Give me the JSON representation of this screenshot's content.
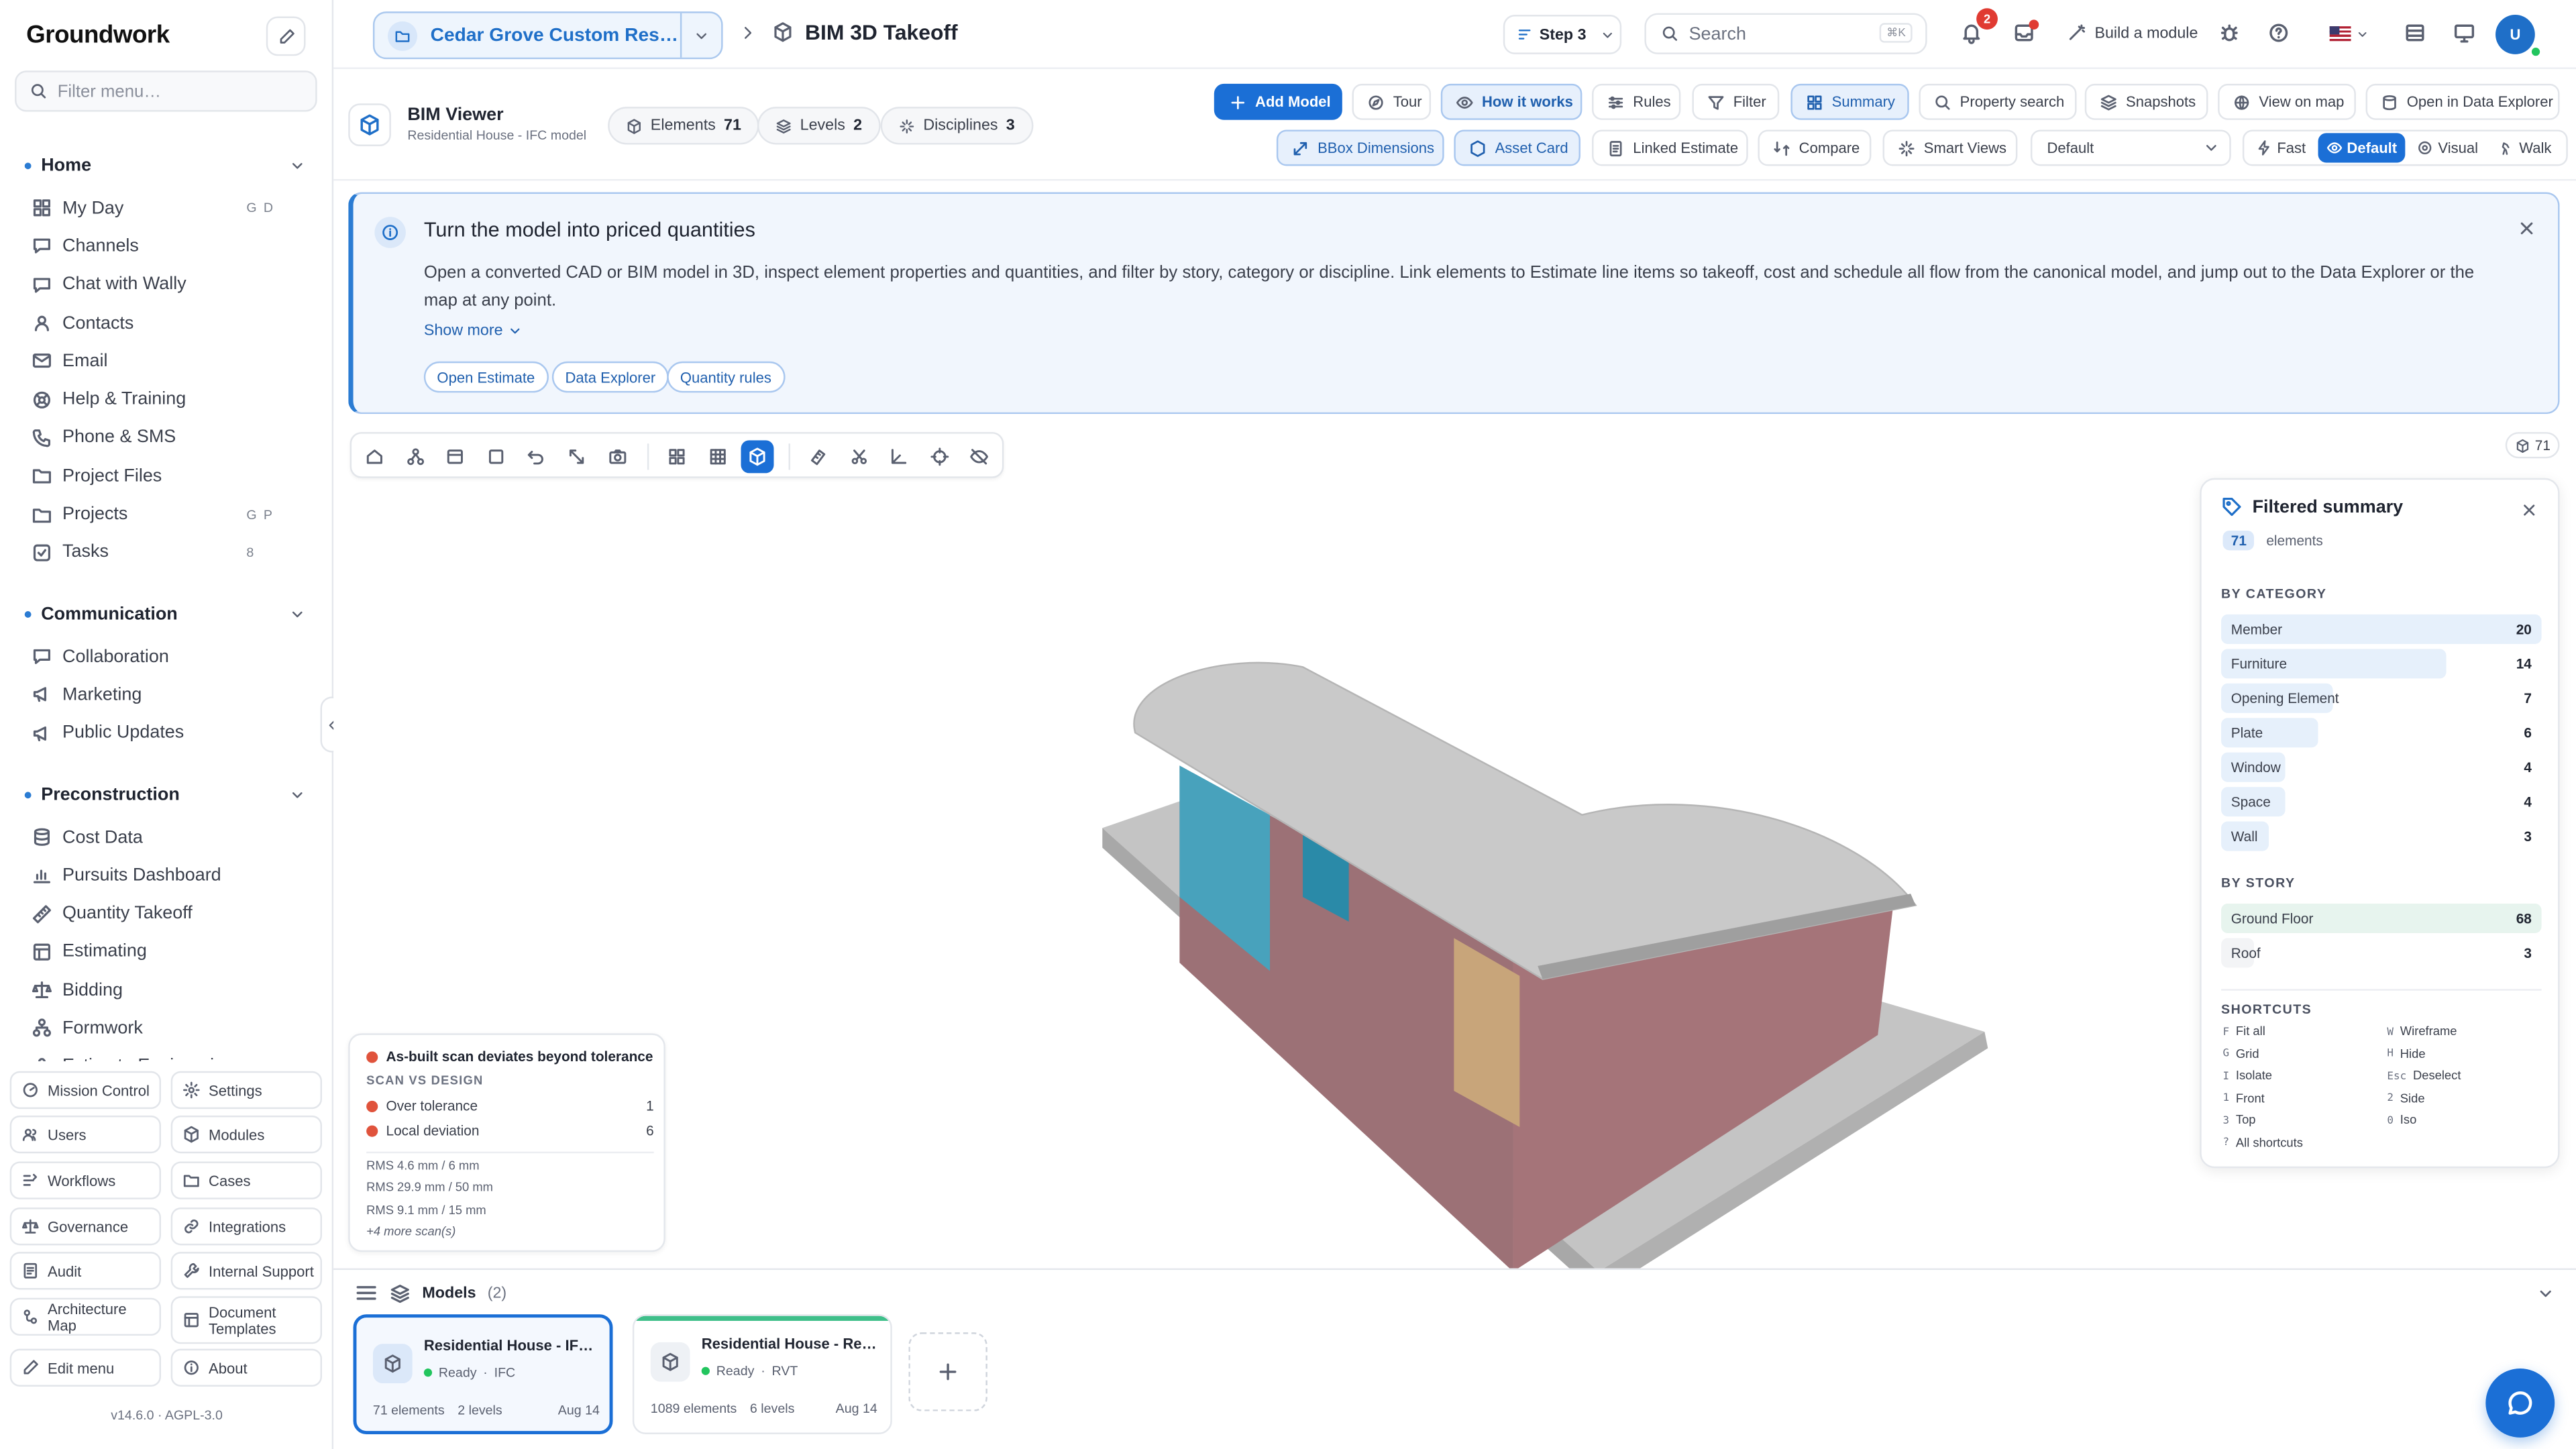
{
  "app": {
    "name": "Groundwork",
    "version": "v14.6.0",
    "license": "AGPL-3.0"
  },
  "sidebar": {
    "filter_placeholder": "Filter menu…",
    "sections": [
      {
        "title": "Home",
        "items": [
          {
            "label": "My Day",
            "icon": "grid-icon",
            "kbd": "G D"
          },
          {
            "label": "Channels",
            "icon": "chat-icon"
          },
          {
            "label": "Chat with Wally",
            "icon": "chat-icon"
          },
          {
            "label": "Contacts",
            "icon": "contacts-icon"
          },
          {
            "label": "Email",
            "icon": "mail-icon"
          },
          {
            "label": "Help & Training",
            "icon": "help-icon"
          },
          {
            "label": "Phone & SMS",
            "icon": "phone-icon"
          },
          {
            "label": "Project Files",
            "icon": "folder-icon"
          },
          {
            "label": "Projects",
            "icon": "folder-icon",
            "kbd": "G P"
          },
          {
            "label": "Tasks",
            "icon": "check-icon",
            "kbd": "8"
          }
        ]
      },
      {
        "title": "Communication",
        "items": [
          {
            "label": "Collaboration",
            "icon": "chat-icon"
          },
          {
            "label": "Marketing",
            "icon": "megaphone-icon"
          },
          {
            "label": "Public Updates",
            "icon": "megaphone-icon"
          }
        ]
      },
      {
        "title": "Preconstruction",
        "items": [
          {
            "label": "Cost Data",
            "icon": "database-icon"
          },
          {
            "label": "Pursuits Dashboard",
            "icon": "chart-icon"
          },
          {
            "label": "Quantity Takeoff",
            "icon": "ruler-icon"
          },
          {
            "label": "Estimating",
            "icon": "table-icon"
          },
          {
            "label": "Bidding",
            "icon": "scale-icon"
          },
          {
            "label": "Formwork",
            "icon": "hierarchy-icon"
          },
          {
            "label": "Estimate Engineering",
            "icon": "hierarchy-icon"
          }
        ]
      }
    ],
    "bottom_buttons": [
      {
        "label": "Mission Control",
        "icon": "gauge-icon"
      },
      {
        "label": "Settings",
        "icon": "gear-icon"
      },
      {
        "label": "Users",
        "icon": "users-icon"
      },
      {
        "label": "Modules",
        "icon": "cube-icon"
      },
      {
        "label": "Workflows",
        "icon": "workflow-icon"
      },
      {
        "label": "Cases",
        "icon": "folder-icon"
      },
      {
        "label": "Governance",
        "icon": "scale-icon"
      },
      {
        "label": "Integrations",
        "icon": "link-icon"
      },
      {
        "label": "Audit",
        "icon": "audit-icon"
      },
      {
        "label": "Internal Support",
        "icon": "wrench-icon"
      },
      {
        "label": "Architecture Map",
        "icon": "map-icon"
      },
      {
        "label": "Document Templates",
        "icon": "template-icon"
      },
      {
        "label": "Edit menu",
        "icon": "pencil-icon"
      },
      {
        "label": "About",
        "icon": "info-icon"
      }
    ]
  },
  "topbar": {
    "project": "Cedar Grove Custom Residence",
    "page_title": "BIM 3D Takeoff",
    "step": "Step 3",
    "search_placeholder": "Search",
    "search_kbd": "⌘K",
    "notifications_count": "2",
    "build_module": "Build a module",
    "avatar_initial": "U"
  },
  "viewer": {
    "title": "BIM Viewer",
    "subtitle": "Residential House - IFC model",
    "chips": [
      {
        "label": "Elements",
        "value": "71"
      },
      {
        "label": "Levels",
        "value": "2"
      },
      {
        "label": "Disciplines",
        "value": "3"
      }
    ],
    "actions_row1": [
      "Add Model",
      "Tour",
      "How it works",
      "Rules",
      "Filter",
      "Summary",
      "Property search",
      "Snapshots",
      "View on map",
      "Open in Data Explorer"
    ],
    "actions_row2": [
      "BBox Dimensions",
      "Asset Card",
      "Linked Estimate",
      "Compare",
      "Smart Views"
    ],
    "view_select": "Default",
    "modes": [
      "Fast",
      "Default",
      "Visual",
      "Walk"
    ],
    "active_mode": "Default"
  },
  "banner": {
    "title": "Turn the model into priced quantities",
    "description": "Open a converted CAD or BIM model in 3D, inspect element properties and quantities, and filter by story, category or discipline. Link elements to Estimate line items so takeoff, cost and schedule all flow from the canonical model, and jump out to the Data Explorer or the map at any point.",
    "show_more": "Show more",
    "links": [
      "Open Estimate",
      "Data Explorer",
      "Quantity rules"
    ]
  },
  "viewport": {
    "element_count": "71"
  },
  "scan": {
    "title": "As-built scan deviates beyond tolerance",
    "caption": "SCAN VS DESIGN",
    "rows": [
      {
        "label": "Over tolerance",
        "value": "1"
      },
      {
        "label": "Local deviation",
        "value": "6"
      }
    ],
    "rms": [
      "RMS 4.6 mm / 6 mm",
      "RMS 29.9 mm / 50 mm",
      "RMS 9.1 mm / 15 mm"
    ],
    "more": "+4 more scan(s)"
  },
  "summary": {
    "title": "Filtered summary",
    "count": "71",
    "count_label": "elements",
    "by_category_label": "BY CATEGORY",
    "by_category": [
      {
        "label": "Member",
        "value": 20
      },
      {
        "label": "Furniture",
        "value": 14
      },
      {
        "label": "Opening Element",
        "value": 7
      },
      {
        "label": "Plate",
        "value": 6
      },
      {
        "label": "Window",
        "value": 4
      },
      {
        "label": "Space",
        "value": 4
      },
      {
        "label": "Wall",
        "value": 3
      }
    ],
    "by_story_label": "BY STORY",
    "by_story": [
      {
        "label": "Ground Floor",
        "value": 68
      },
      {
        "label": "Roof",
        "value": 3
      }
    ],
    "shortcuts_label": "SHORTCUTS",
    "shortcuts": [
      {
        "key": "F",
        "label": "Fit all"
      },
      {
        "key": "W",
        "label": "Wireframe"
      },
      {
        "key": "G",
        "label": "Grid"
      },
      {
        "key": "H",
        "label": "Hide"
      },
      {
        "key": "I",
        "label": "Isolate"
      },
      {
        "key": "Esc",
        "label": "Deselect"
      },
      {
        "key": "1",
        "label": "Front"
      },
      {
        "key": "2",
        "label": "Side"
      },
      {
        "key": "3",
        "label": "Top"
      },
      {
        "key": "0",
        "label": "Iso"
      },
      {
        "key": "?",
        "label": "All shortcuts"
      }
    ]
  },
  "models": {
    "title": "Models",
    "count": "(2)",
    "items": [
      {
        "name": "Residential House - IFC model",
        "status": "Ready",
        "format": "IFC",
        "elements": "71 elements",
        "levels": "2 levels",
        "date": "Aug 14"
      },
      {
        "name": "Residential House - Revit model",
        "status": "Ready",
        "format": "RVT",
        "elements": "1089 elements",
        "levels": "6 levels",
        "date": "Aug 14"
      }
    ]
  },
  "colors": {
    "accent": "#1b6fd6",
    "wall": "#9c7176",
    "roof": "#c9c9c9",
    "glass": "#3fa7c4",
    "door": "#c8a57a",
    "slab": "#b7b7b7"
  }
}
